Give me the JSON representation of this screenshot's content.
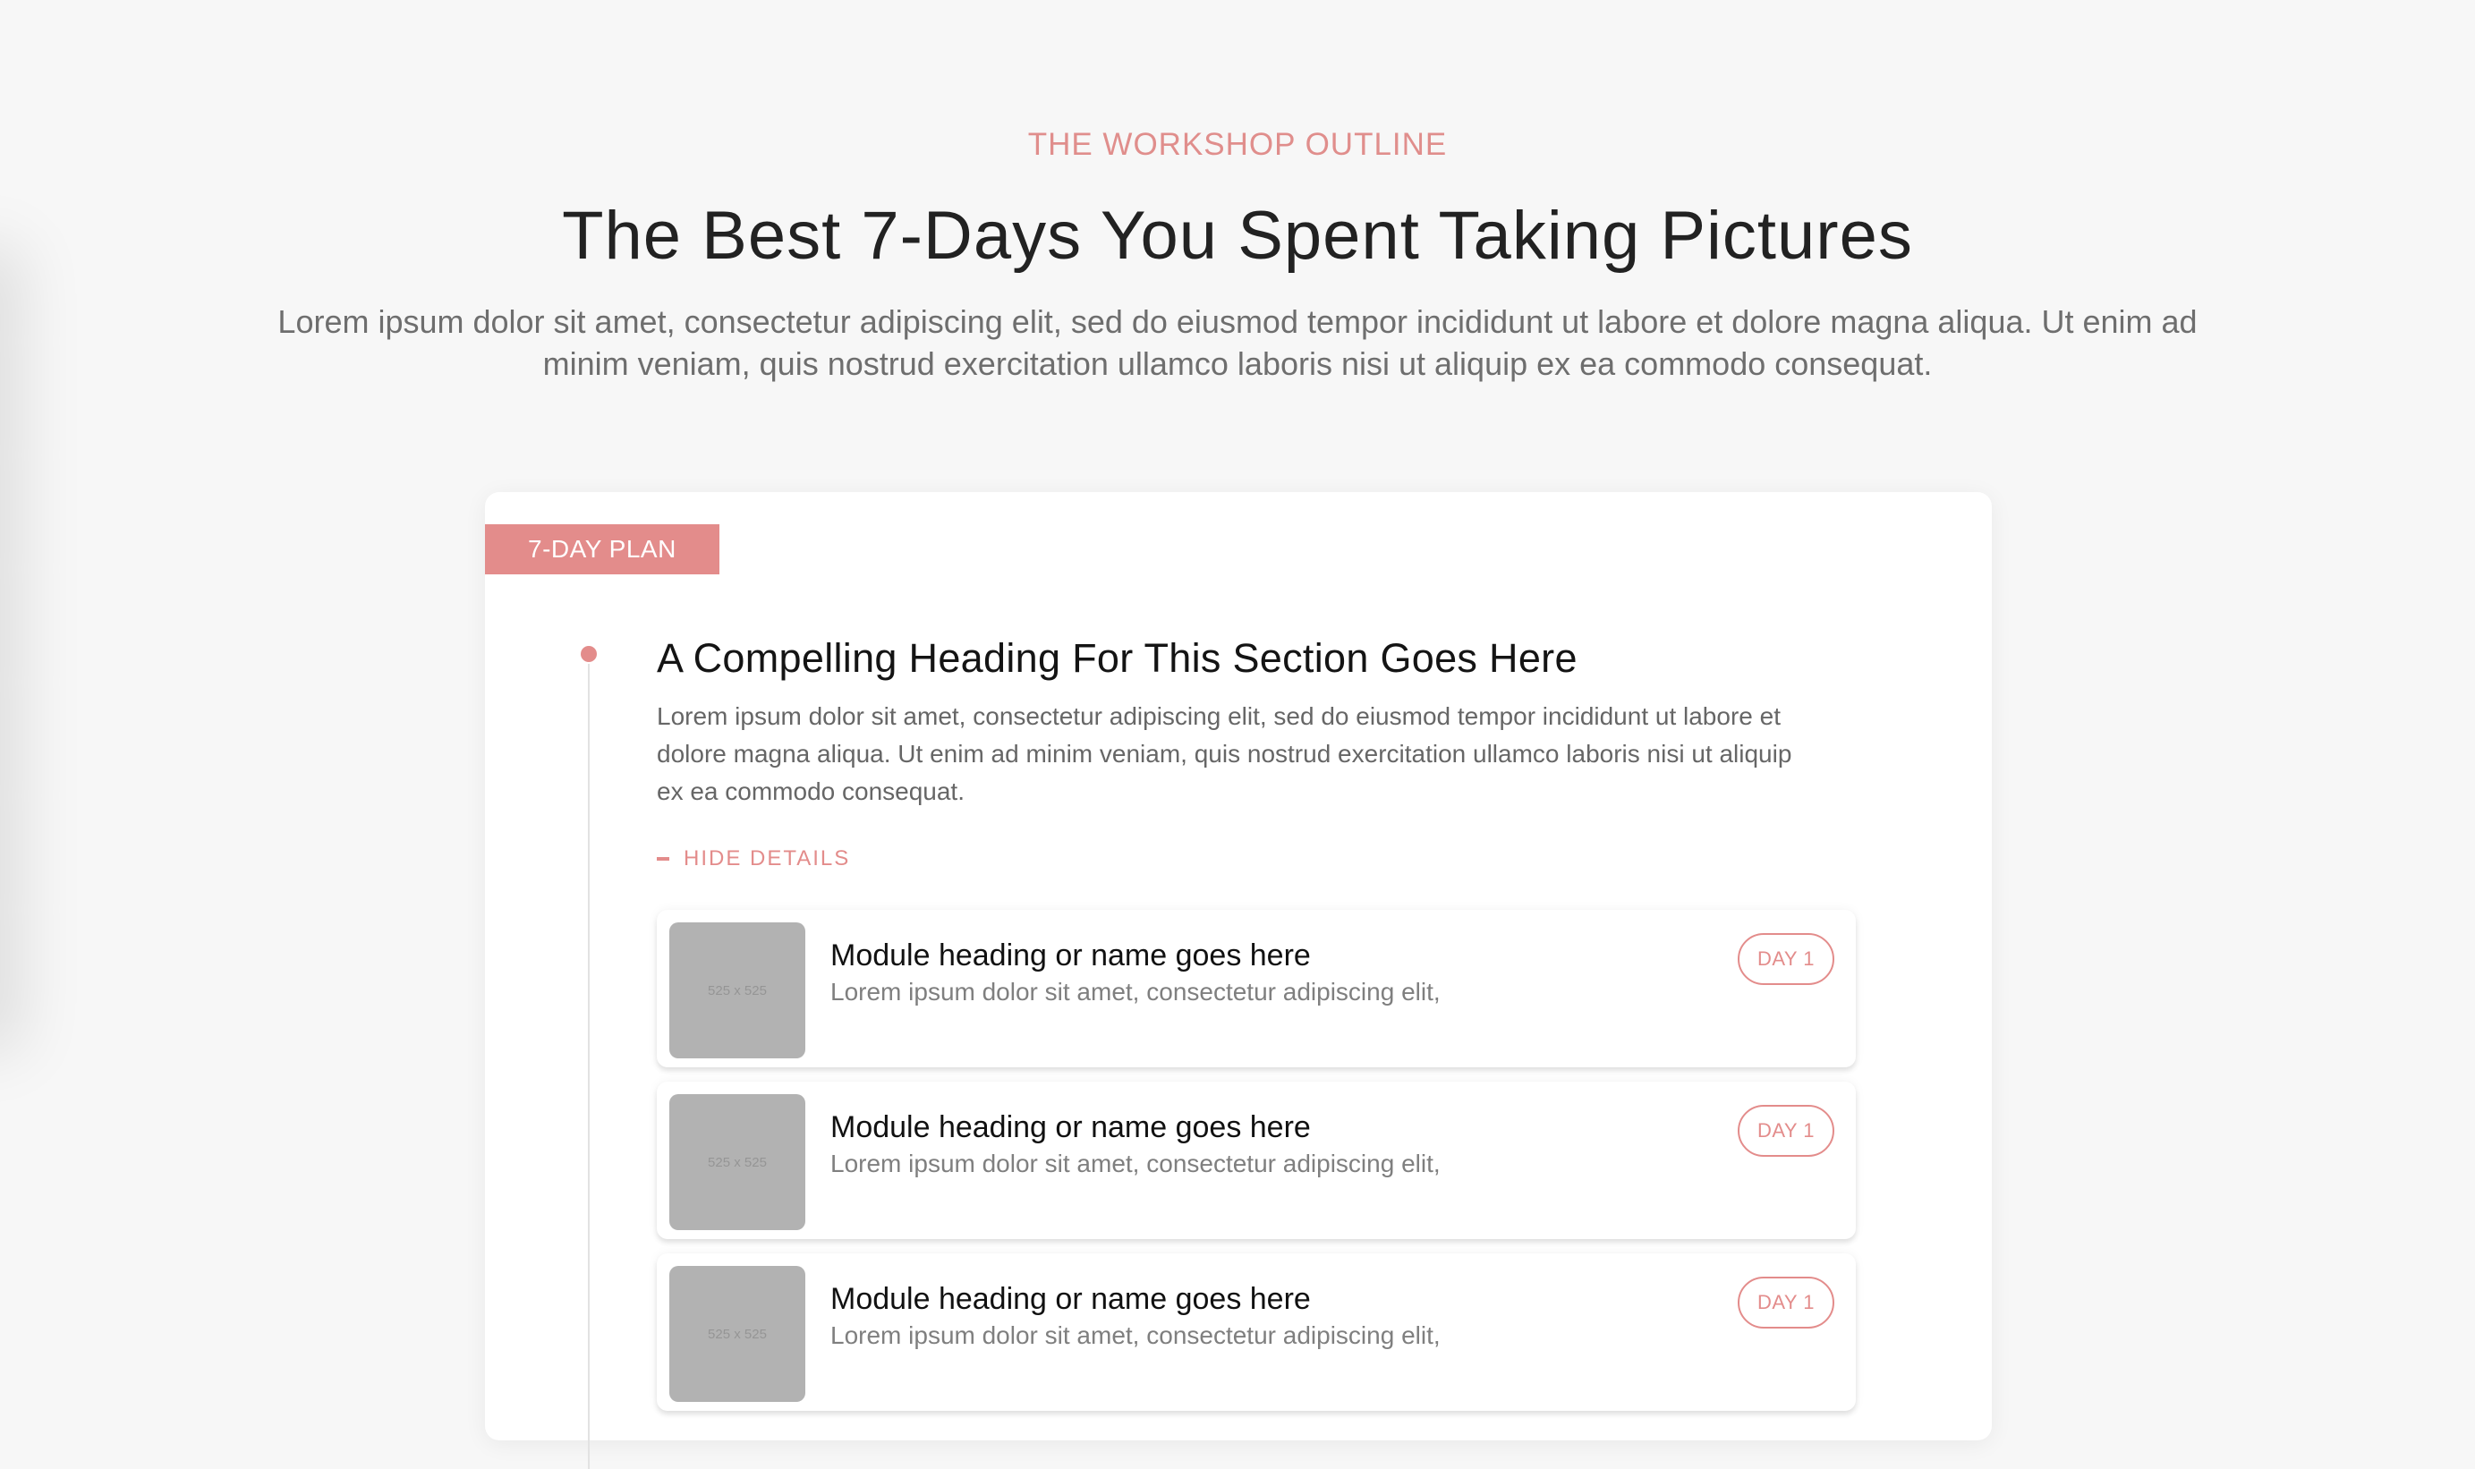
{
  "header": {
    "eyebrow": "THE WORKSHOP OUTLINE",
    "title": "The Best 7-Days You Spent Taking Pictures",
    "lead": "Lorem ipsum dolor sit amet, consectetur adipiscing elit, sed do eiusmod tempor incididunt ut labore et dolore magna aliqua. Ut enim ad minim veniam, quis nostrud exercitation ullamco laboris nisi ut aliquip ex ea commodo consequat."
  },
  "card": {
    "tag": "7-DAY PLAN",
    "heading": "A Compelling Heading For This Section Goes Here",
    "text": "Lorem ipsum dolor sit amet, consectetur adipiscing elit, sed do eiusmod tempor incididunt ut labore et dolore magna aliqua. Ut enim ad minim veniam, quis nostrud exercitation ullamco laboris nisi ut aliquip ex ea commodo consequat.",
    "toggle_label": "HIDE DETAILS"
  },
  "modules": [
    {
      "thumb": "525 x 525",
      "title": "Module heading or name goes here",
      "desc": "Lorem ipsum dolor sit amet, consectetur adipiscing elit,",
      "day": "DAY 1"
    },
    {
      "thumb": "525 x 525",
      "title": "Module heading or name goes here",
      "desc": "Lorem ipsum dolor sit amet, consectetur adipiscing elit,",
      "day": "DAY 1"
    },
    {
      "thumb": "525 x 525",
      "title": "Module heading or name goes here",
      "desc": "Lorem ipsum dolor sit amet, consectetur adipiscing elit,",
      "day": "DAY 1"
    }
  ],
  "colors": {
    "accent": "#e38c8b",
    "background": "#f7f7f7",
    "card": "#ffffff",
    "placeholder": "#b2b2b2"
  },
  "icons": {
    "toggle": "minus-icon"
  }
}
